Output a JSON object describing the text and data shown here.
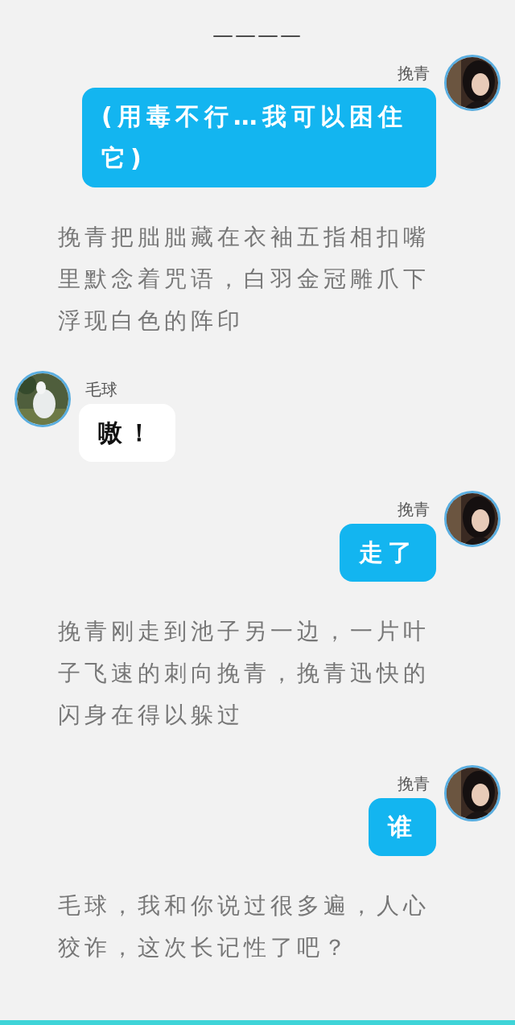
{
  "header": {
    "divider_text": "————"
  },
  "items": [
    {
      "kind": "sent",
      "sender": "挽青",
      "text": "(用毒不行…我可以困住它)"
    },
    {
      "kind": "narration",
      "text": "挽青把朏朏藏在衣袖五指相扣嘴里默念着咒语，白羽金冠雕爪下浮现白色的阵印"
    },
    {
      "kind": "received",
      "sender": "毛球",
      "text": "嗷！"
    },
    {
      "kind": "sent",
      "sender": "挽青",
      "text": "走了"
    },
    {
      "kind": "narration",
      "text": "挽青刚走到池子另一边，一片叶子飞速的刺向挽青，挽青迅快的闪身在得以躲过"
    },
    {
      "kind": "sent",
      "sender": "挽青",
      "text": "谁"
    },
    {
      "kind": "narration",
      "text": "毛球，我和你说过很多遍，人心狡诈，这次长记性了吧？"
    }
  ]
}
